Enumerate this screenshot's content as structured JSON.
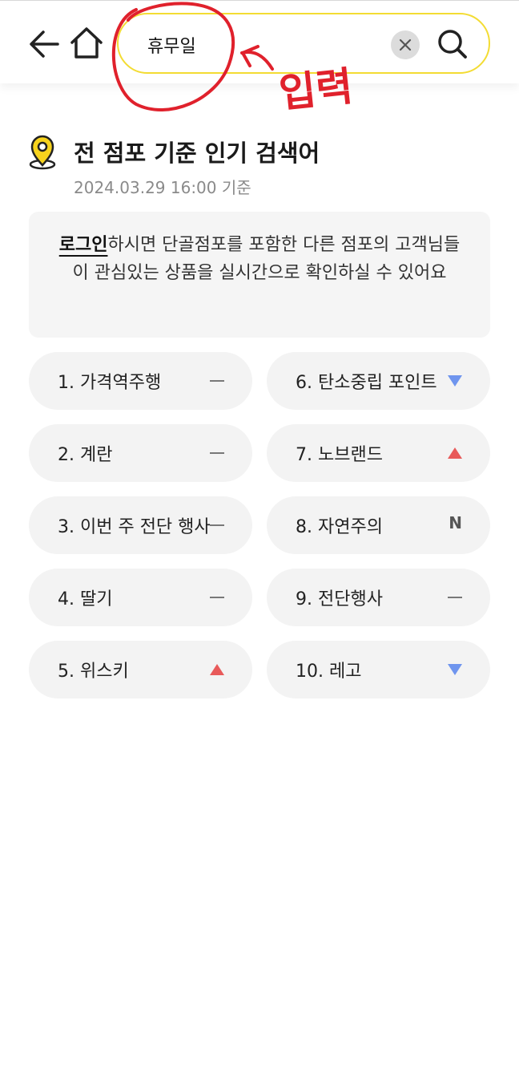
{
  "header": {
    "search_value": "휴무일"
  },
  "annotation": {
    "text": "입력"
  },
  "section": {
    "title": "전 점포 기준 인기 검색어",
    "timestamp": "2024.03.29 16:00 기준"
  },
  "notice": {
    "login_link": "로그인",
    "message": "하시면 단골점포를 포함한 다른 점포의 고객님들이 관심있는 상품을 실시간으로 확인하실 수 있어요"
  },
  "colors": {
    "search_border": "#f3dc33",
    "trend_up": "#e85a5a",
    "trend_down": "#6f95ee",
    "annotation": "#e0212c"
  },
  "rankings": [
    {
      "label": "1. 가격역주행",
      "trend": "same"
    },
    {
      "label": "2. 계란",
      "trend": "same"
    },
    {
      "label": "3. 이번 주 전단 행사",
      "trend": "same"
    },
    {
      "label": "4. 딸기",
      "trend": "same"
    },
    {
      "label": "5. 위스키",
      "trend": "up"
    },
    {
      "label": "6. 탄소중립 포인트",
      "trend": "down"
    },
    {
      "label": "7. 노브랜드",
      "trend": "up"
    },
    {
      "label": "8. 자연주의",
      "trend": "new",
      "badge": "N"
    },
    {
      "label": "9. 전단행사",
      "trend": "same"
    },
    {
      "label": "10. 레고",
      "trend": "down"
    }
  ]
}
